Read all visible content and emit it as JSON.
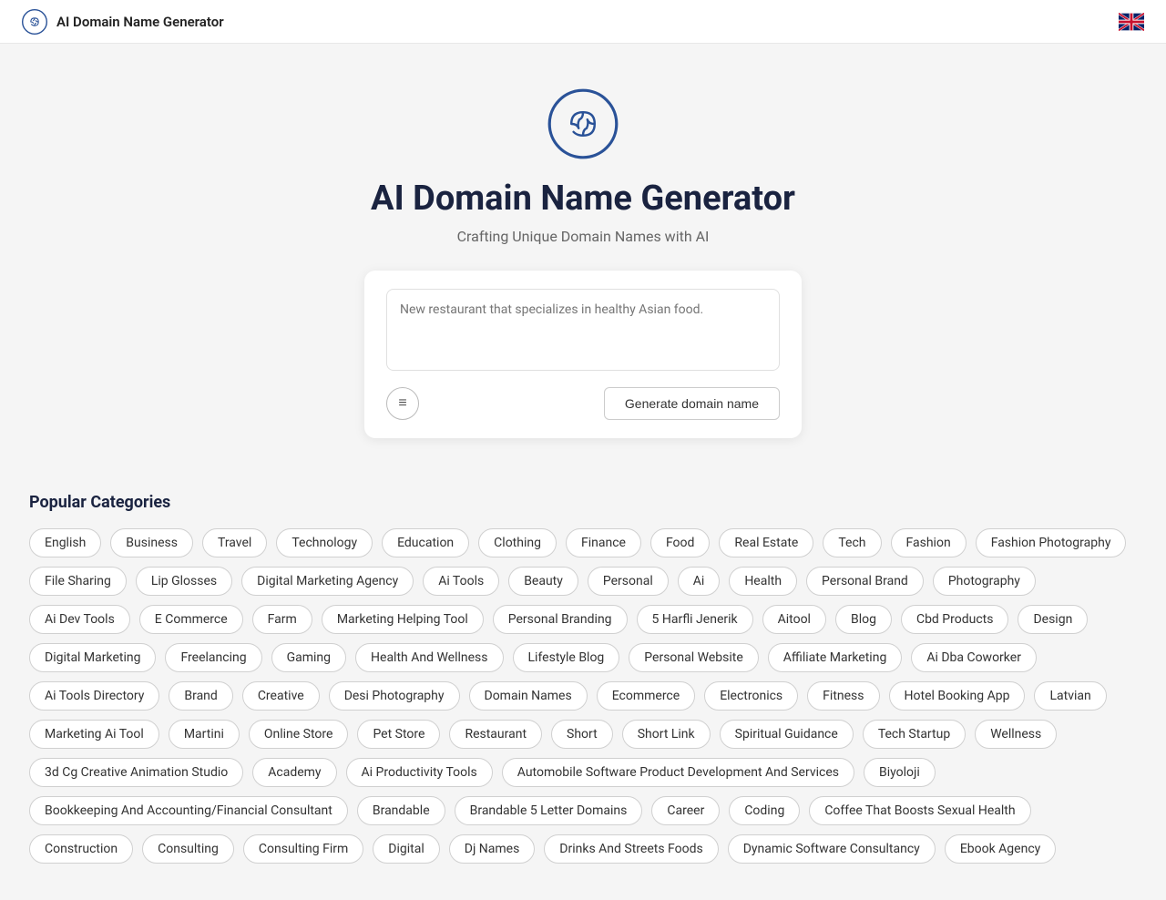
{
  "navbar": {
    "title": "AI Domain Name Generator",
    "logo_label": "brain-logo",
    "flag_label": "uk-flag"
  },
  "hero": {
    "title": "AI Domain Name Generator",
    "subtitle": "Crafting Unique Domain Names with AI",
    "logo_label": "brain-icon"
  },
  "search": {
    "placeholder": "New restaurant that specializes in healthy Asian food.",
    "filter_icon": "≡",
    "generate_btn": "Generate domain name"
  },
  "categories": {
    "section_title": "Popular Categories",
    "tags": [
      "English",
      "Business",
      "Travel",
      "Technology",
      "Education",
      "Clothing",
      "Finance",
      "Food",
      "Real Estate",
      "Tech",
      "Fashion",
      "Fashion Photography",
      "File Sharing",
      "Lip Glosses",
      "Digital Marketing Agency",
      "Ai Tools",
      "Beauty",
      "Personal",
      "Ai",
      "Health",
      "Personal Brand",
      "Photography",
      "Ai Dev Tools",
      "E Commerce",
      "Farm",
      "Marketing Helping Tool",
      "Personal Branding",
      "5 Harfli Jenerik",
      "Aitool",
      "Blog",
      "Cbd Products",
      "Design",
      "Digital Marketing",
      "Freelancing",
      "Gaming",
      "Health And Wellness",
      "Lifestyle Blog",
      "Personal Website",
      "Affiliate Marketing",
      "Ai Dba Coworker",
      "Ai Tools Directory",
      "Brand",
      "Creative",
      "Desi Photography",
      "Domain Names",
      "Ecommerce",
      "Electronics",
      "Fitness",
      "Hotel Booking App",
      "Latvian",
      "Marketing Ai Tool",
      "Martini",
      "Online Store",
      "Pet Store",
      "Restaurant",
      "Short",
      "Short Link",
      "Spiritual Guidance",
      "Tech Startup",
      "Wellness",
      "3d Cg Creative Animation Studio",
      "Academy",
      "Ai Productivity Tools",
      "Automobile Software Product Development And Services",
      "Biyoloji",
      "Bookkeeping And Accounting/Financial Consultant",
      "Brandable",
      "Brandable 5 Letter Domains",
      "Career",
      "Coding",
      "Coffee That Boosts Sexual Health",
      "Construction",
      "Consulting",
      "Consulting Firm",
      "Digital",
      "Dj Names",
      "Drinks And Streets Foods",
      "Dynamic Software Consultancy",
      "Ebook Agency"
    ]
  }
}
